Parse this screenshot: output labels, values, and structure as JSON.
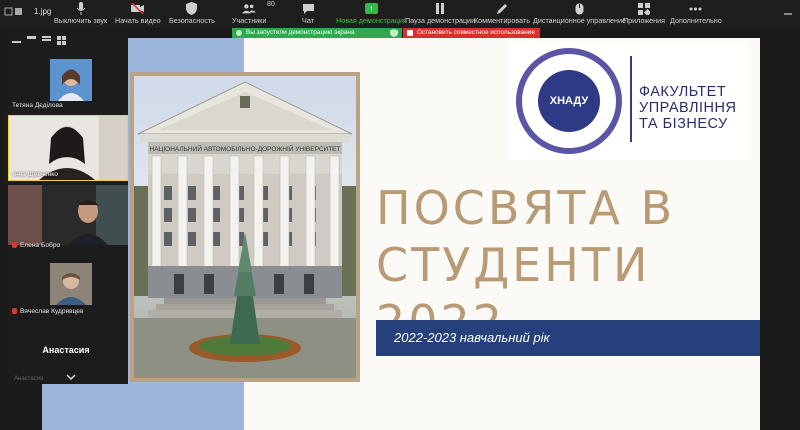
{
  "window": {
    "tab_title": "1.jpg"
  },
  "toolbar": {
    "items": [
      {
        "label": "Выключить звук"
      },
      {
        "label": "Начать видео"
      },
      {
        "label": "Безопасность"
      },
      {
        "label": "Участники",
        "count": "80"
      },
      {
        "label": "Чат"
      },
      {
        "label": "Новая демонстрация"
      },
      {
        "label": "Пауза демонстрации"
      },
      {
        "label": "Комментировать"
      },
      {
        "label": "Дистанционное управление"
      },
      {
        "label": "Приложения"
      },
      {
        "label": "Дополнительно"
      }
    ]
  },
  "notifications": {
    "sharing": "Вы запустили демонстрацию экрана",
    "stop": "Остановить совместное использование"
  },
  "slide": {
    "logo_title": "ФАКУЛЬТЕТ УПРАВЛІННЯ ТА БІЗНЕСУ",
    "logo_abbr": "ХНАДУ",
    "building_sign": "НАЦІОНАЛЬНИЙ АВТОМОБІЛЬНО-ДОРОЖНІЙ УНІВЕРСИТЕТ",
    "title_line1": "ПОСВЯТА В",
    "title_line2": "СТУДЕНТИ 2022",
    "year_text": "2022-2023 навчальний рік"
  },
  "participants": [
    {
      "name": "Тетяна Дєдiлова",
      "muted": false
    },
    {
      "name": "Інна Шевченко",
      "muted": false
    },
    {
      "name": "Елена Бобро",
      "muted": true
    },
    {
      "name": "Вячеслав Кудрявцев",
      "muted": true
    }
  ],
  "host_name": "Анастасия",
  "host_footer": "Анастасия",
  "colors": {
    "accent_green": "#2fa84f",
    "stop_red": "#d9302b",
    "title_gold": "#b89a74",
    "year_bar": "#25407a"
  }
}
